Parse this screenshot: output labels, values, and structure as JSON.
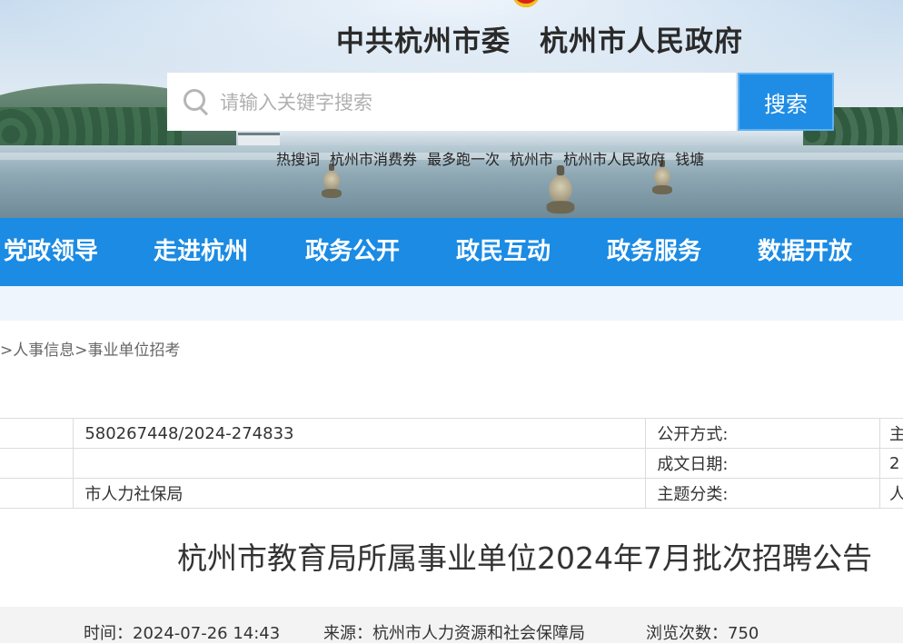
{
  "header": {
    "site_title": "中共杭州市委　杭州市人民政府",
    "search": {
      "placeholder": "请输入关键字搜索",
      "button_label": "搜索"
    },
    "hotwords_label": "热搜词",
    "hotwords": [
      "杭州市消费券",
      "最多跑一次",
      "杭州市",
      "杭州市人民政府",
      "钱塘"
    ]
  },
  "nav": {
    "items": [
      "党政领导",
      "走进杭州",
      "政务公开",
      "政民互动",
      "政务服务",
      "数据开放"
    ]
  },
  "breadcrumb": {
    "sep": ">",
    "items": [
      "人事信息",
      "事业单位招考"
    ]
  },
  "info_table": {
    "rows": [
      {
        "value": "580267448/2024-274833",
        "label": "公开方式:",
        "right": "主"
      },
      {
        "value": "",
        "label": "成文日期:",
        "right": "2"
      },
      {
        "value": "市人力社保局",
        "label": "主题分类:",
        "right": "人"
      }
    ]
  },
  "article": {
    "title": "杭州市教育局所属事业单位2024年7月批次招聘公告",
    "time": "时间：2024-07-26 14:43",
    "source": "来源：杭州市人力资源和社会保障局",
    "views": "浏览次数：750"
  },
  "colors": {
    "nav_blue": "#1b8be4",
    "search_blue": "#1f8de6"
  }
}
